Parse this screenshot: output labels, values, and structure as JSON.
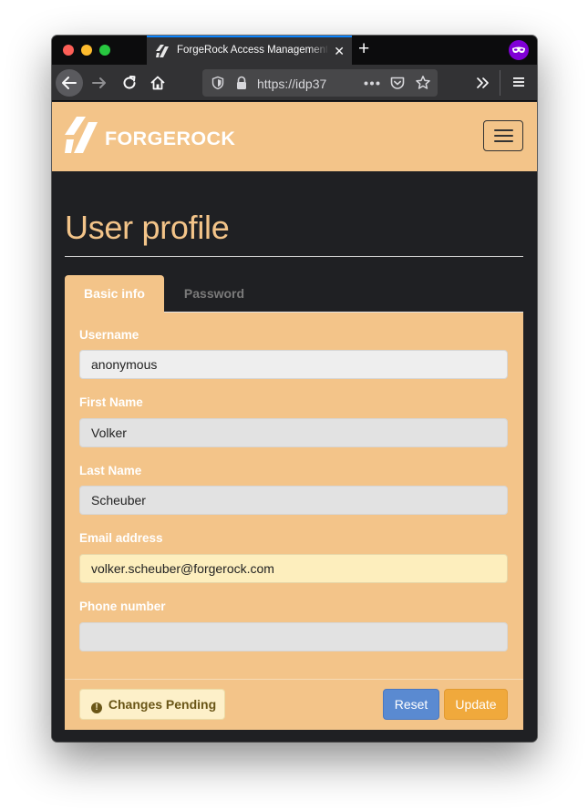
{
  "browser": {
    "tab_title": "ForgeRock Access Management",
    "url": "https://idp37",
    "new_tab_symbol": "+",
    "close_symbol": "✕"
  },
  "site": {
    "brand_name": "FORGEROCK",
    "menu_icon": "hamburger-icon",
    "brand_color": "#f3c489"
  },
  "page": {
    "title": "User profile",
    "tabs": [
      {
        "label": "Basic info",
        "active": true
      },
      {
        "label": "Password",
        "active": false
      }
    ]
  },
  "form": {
    "fields": [
      {
        "label": "Username",
        "value": "anonymous"
      },
      {
        "label": "First Name",
        "value": "Volker"
      },
      {
        "label": "Last Name",
        "value": "Scheuber"
      },
      {
        "label": "Email address",
        "value": "volker.scheuber@forgerock.com"
      },
      {
        "label": "Phone number",
        "value": ""
      }
    ]
  },
  "footer": {
    "pending_label": "Changes Pending",
    "reset_label": "Reset",
    "update_label": "Update",
    "reset_color": "#5a8ad1",
    "update_color": "#f0a93c"
  }
}
